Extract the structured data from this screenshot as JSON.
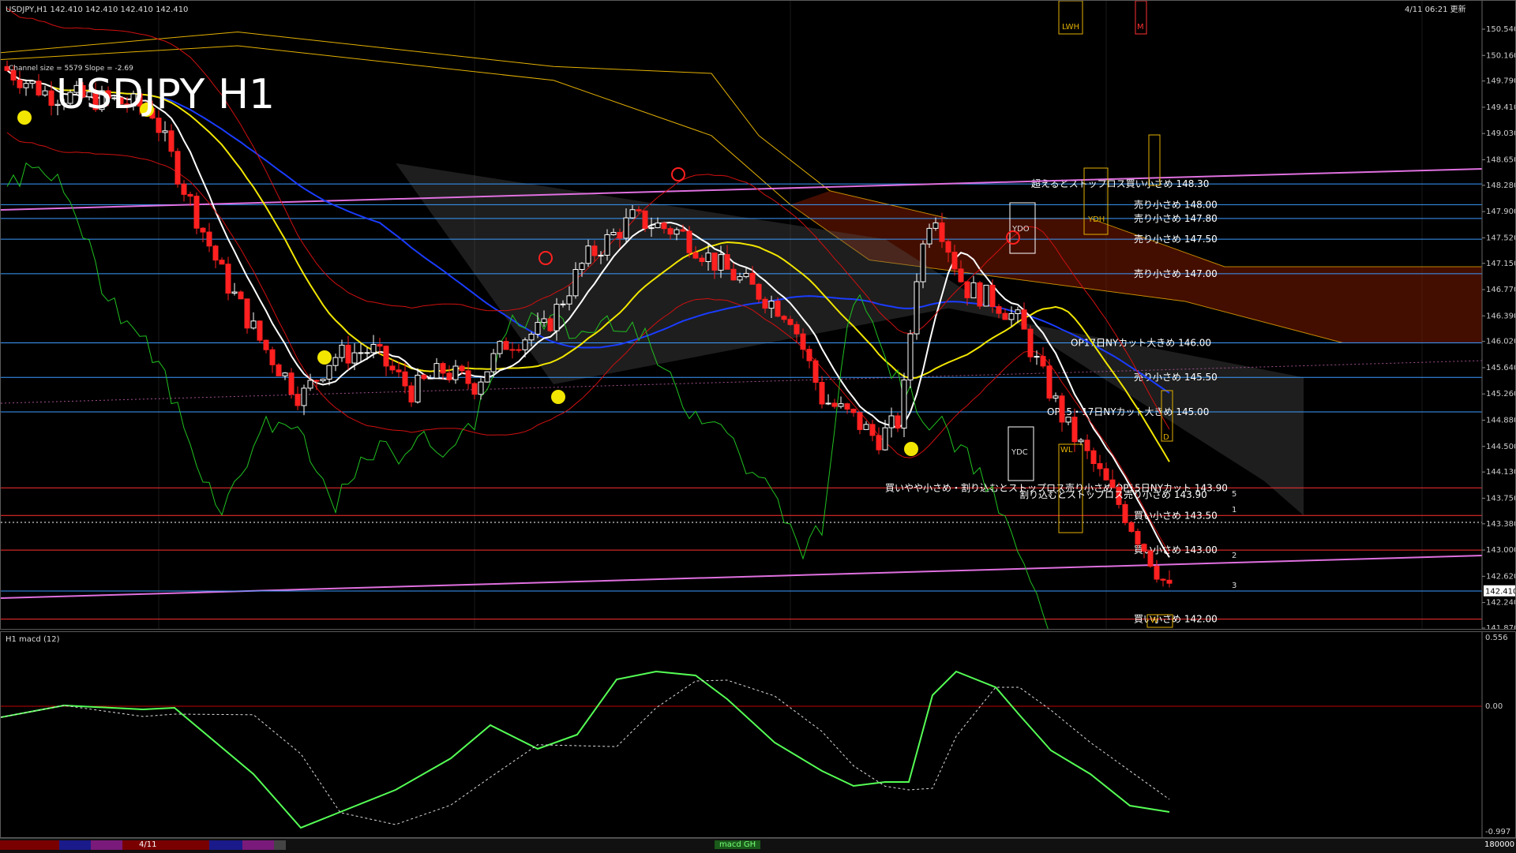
{
  "header": {
    "symbol_info": "USDJPY,H1  142.410 142.410 142.410 142.410",
    "datetime": "4/11 06:21 更新",
    "channel_info": "Channel size = 5579 Slope = -2.69",
    "big_title": "USDJPY H1"
  },
  "price_axis": {
    "ticks": [
      "150.540",
      "150.160",
      "149.790",
      "149.410",
      "149.030",
      "148.650",
      "148.280",
      "147.900",
      "147.520",
      "147.150",
      "146.770",
      "146.390",
      "146.020",
      "145.640",
      "145.260",
      "144.880",
      "144.500",
      "144.130",
      "143.750",
      "143.380",
      "143.000",
      "142.620",
      "142.240",
      "141.870"
    ],
    "current_price": "142.410"
  },
  "levels": [
    {
      "price": 148.3,
      "label": "超えるとストップロス買い小さめ 148.30",
      "color": "#3a9bff"
    },
    {
      "price": 148.0,
      "label": "売り小さめ 148.00",
      "color": "#3a9bff"
    },
    {
      "price": 147.8,
      "label": "売り小さめ 147.80",
      "color": "#3a9bff"
    },
    {
      "price": 147.5,
      "label": "売り小さめ 147.50",
      "color": "#3a9bff"
    },
    {
      "price": 147.0,
      "label": "売り小さめ 147.00",
      "color": "#3a9bff"
    },
    {
      "price": 146.0,
      "label": "OP17日NYカット大きめ 146.00",
      "color": "#3a9bff"
    },
    {
      "price": 145.5,
      "label": "売り小さめ 145.50",
      "color": "#3a9bff"
    },
    {
      "price": 145.0,
      "label": "OP15・17日NYカット大きめ 145.00",
      "color": "#3a9bff"
    },
    {
      "price": 143.9,
      "label": "買いやや小さめ・割り込むとストップロス売り小さめ OP15日NYカット 143.90",
      "color": "#ff3030"
    },
    {
      "price": 143.5,
      "label": "買い小さめ 143.50",
      "color": "#ff3030"
    },
    {
      "price": 143.0,
      "label": "買い小さめ 143.00",
      "color": "#ff3030"
    },
    {
      "price": 142.0,
      "label": "買い小さめ 142.00",
      "color": "#ff3030"
    }
  ],
  "extra_label": "割り込むとストップロス売り小さめ 143.90",
  "box_labels": {
    "ydo": "YDO",
    "ydh": "YDH",
    "ydc": "YDC",
    "lwh": "LWH",
    "m": "M",
    "wl": "WL",
    "w": "W",
    "d": "D"
  },
  "fib_labels": [
    "5",
    "1",
    "2",
    "3"
  ],
  "macd": {
    "label": "H1  macd (12)",
    "ticks": [
      "0.556",
      "0.00",
      "-0.997"
    ]
  },
  "bottom_bar": {
    "date_label": "4/11",
    "right_label": "180000",
    "center_label": "macd GH"
  },
  "colors": {
    "up": "#ffffff",
    "down": "#ff2020",
    "ma_white": "#ffffff",
    "ma_yellow": "#f2e600",
    "ma_blue": "#1a3cff",
    "kumo_gold": "#e3b000",
    "green": "#20c020",
    "bb_red": "#d01010",
    "macd_up": "#55ff55",
    "macd_down": "#ff8fb0"
  }
}
